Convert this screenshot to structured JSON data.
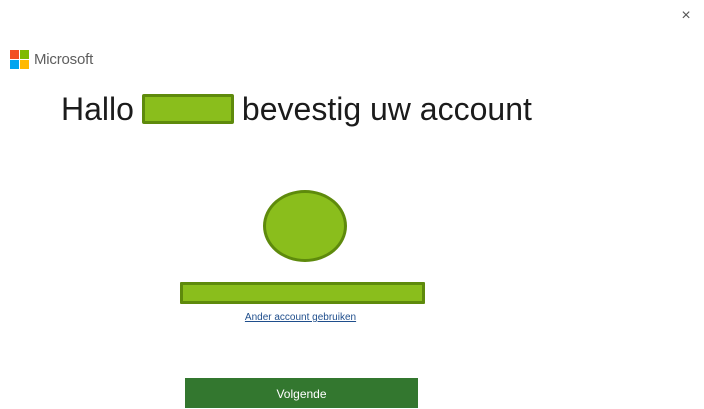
{
  "window": {
    "close_glyph": "×"
  },
  "brand": {
    "name": "Microsoft",
    "logo_icon": "microsoft-logo-icon"
  },
  "heading": {
    "greeting": "Hallo",
    "suffix": "bevestig uw account"
  },
  "account": {
    "switch_link": "Ander account gebruiken"
  },
  "actions": {
    "next_label": "Volgende"
  },
  "colors": {
    "logo_red": "#f25022",
    "logo_green": "#7fba00",
    "logo_blue": "#00a4ef",
    "logo_yellow": "#ffb900",
    "redaction_fill": "#8abe1c",
    "redaction_border": "#5e8a0c",
    "link": "#1f4e8c",
    "primary_button": "#33772f"
  }
}
